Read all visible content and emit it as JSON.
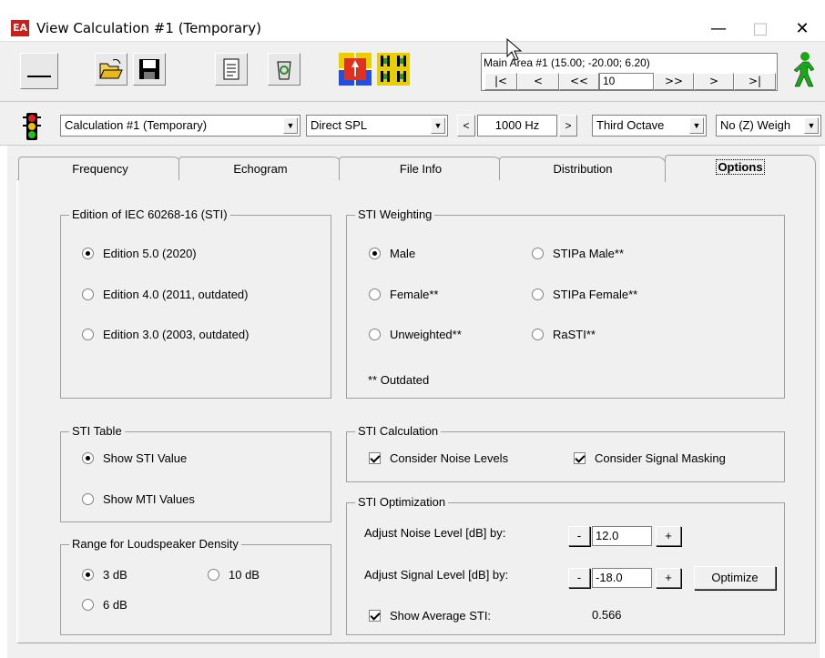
{
  "window": {
    "title": "View Calculation #1 (Temporary)",
    "app_icon_text": "EA",
    "minimize": "—",
    "maximize": "□",
    "close": "✕"
  },
  "navigator": {
    "area_text": "Main Area #1  (15.00; -20.00; 6.20)",
    "buttons": [
      "|<",
      "<",
      "<<",
      ">>",
      ">",
      ">|"
    ],
    "position_value": "10"
  },
  "toolbar2": {
    "calculation": "Calculation #1 (Temporary)",
    "mode": "Direct SPL",
    "freq_prev": "<",
    "frequency": "1000 Hz",
    "freq_next": ">",
    "band": "Third Octave",
    "weighting": "No (Z) Weigh"
  },
  "tabs": [
    "Frequency",
    "Echogram",
    "File Info",
    "Distribution",
    "Options"
  ],
  "active_tab": "Options",
  "edition_group": {
    "title": "Edition of IEC 60268-16 (STI)",
    "options": [
      {
        "label": "Edition 5.0 (2020)",
        "selected": true
      },
      {
        "label": "Edition 4.0 (2011, outdated)",
        "selected": false
      },
      {
        "label": "Edition 3.0 (2003, outdated)",
        "selected": false
      }
    ]
  },
  "weighting_group": {
    "title": "STI Weighting",
    "options": [
      {
        "label": "Male",
        "selected": true
      },
      {
        "label": "Female**",
        "selected": false
      },
      {
        "label": "Unweighted**",
        "selected": false
      },
      {
        "label": "STIPa Male**",
        "selected": false
      },
      {
        "label": "STIPa Female**",
        "selected": false
      },
      {
        "label": "RaSTI**",
        "selected": false
      }
    ],
    "note": "** Outdated"
  },
  "sti_table_group": {
    "title": "STI Table",
    "options": [
      {
        "label": "Show STI Value",
        "selected": true
      },
      {
        "label": "Show MTI Values",
        "selected": false
      }
    ]
  },
  "sti_calc_group": {
    "title": "STI Calculation",
    "noise_label": "Consider Noise Levels",
    "noise_checked": true,
    "masking_label": "Consider Signal Masking",
    "masking_checked": true
  },
  "density_group": {
    "title": "Range for Loudspeaker Density",
    "options": [
      {
        "label": "3 dB",
        "selected": true
      },
      {
        "label": "10 dB",
        "selected": false
      },
      {
        "label": "6 dB",
        "selected": false
      }
    ]
  },
  "optimization_group": {
    "title": "STI Optimization",
    "noise_label": "Adjust Noise Level [dB] by:",
    "noise_value": "12.0",
    "signal_label": "Adjust Signal Level [dB] by:",
    "signal_value": "-18.0",
    "minus": "-",
    "plus": "+",
    "optimize_label": "Optimize",
    "avg_label": "Show Average STI:",
    "avg_checked": true,
    "avg_value": "0.566"
  }
}
